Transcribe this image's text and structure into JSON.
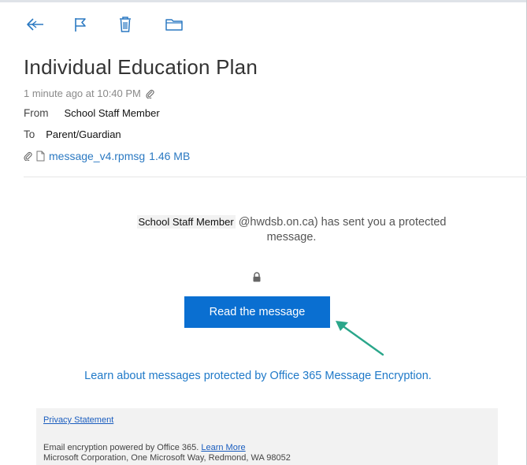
{
  "toolbar": {
    "icons": [
      "reply-icon",
      "flag-icon",
      "trash-icon",
      "folder-icon"
    ],
    "accent": "#2b79c2"
  },
  "email": {
    "subject": "Individual Education Plan",
    "time": "1 minute ago at 10:40 PM",
    "from_label": "From",
    "from_name": "School Staff Member",
    "to_label": "To",
    "to_name": "Parent/Guardian",
    "attachment": {
      "name": "message_v4.rpmsg",
      "size": "1.46 MB"
    }
  },
  "body": {
    "sender_name": "School Staff Member",
    "sent_text_1": "@hwdsb.on.ca) has sent you a protected",
    "sent_text_2": "message.",
    "read_button": "Read the message",
    "learn_link": "Learn about messages protected by Office 365 Message Encryption."
  },
  "footer": {
    "privacy": "Privacy Statement",
    "powered_text": "Email encryption powered by Office 365.",
    "learn_more": "Learn More",
    "address": "Microsoft Corporation, One Microsoft Way, Redmond, WA 98052"
  },
  "colors": {
    "button_bg": "#0a6fd1",
    "link": "#1f79c8",
    "arrow": "#2aa68a",
    "footer_bg": "#f2f2f2"
  }
}
